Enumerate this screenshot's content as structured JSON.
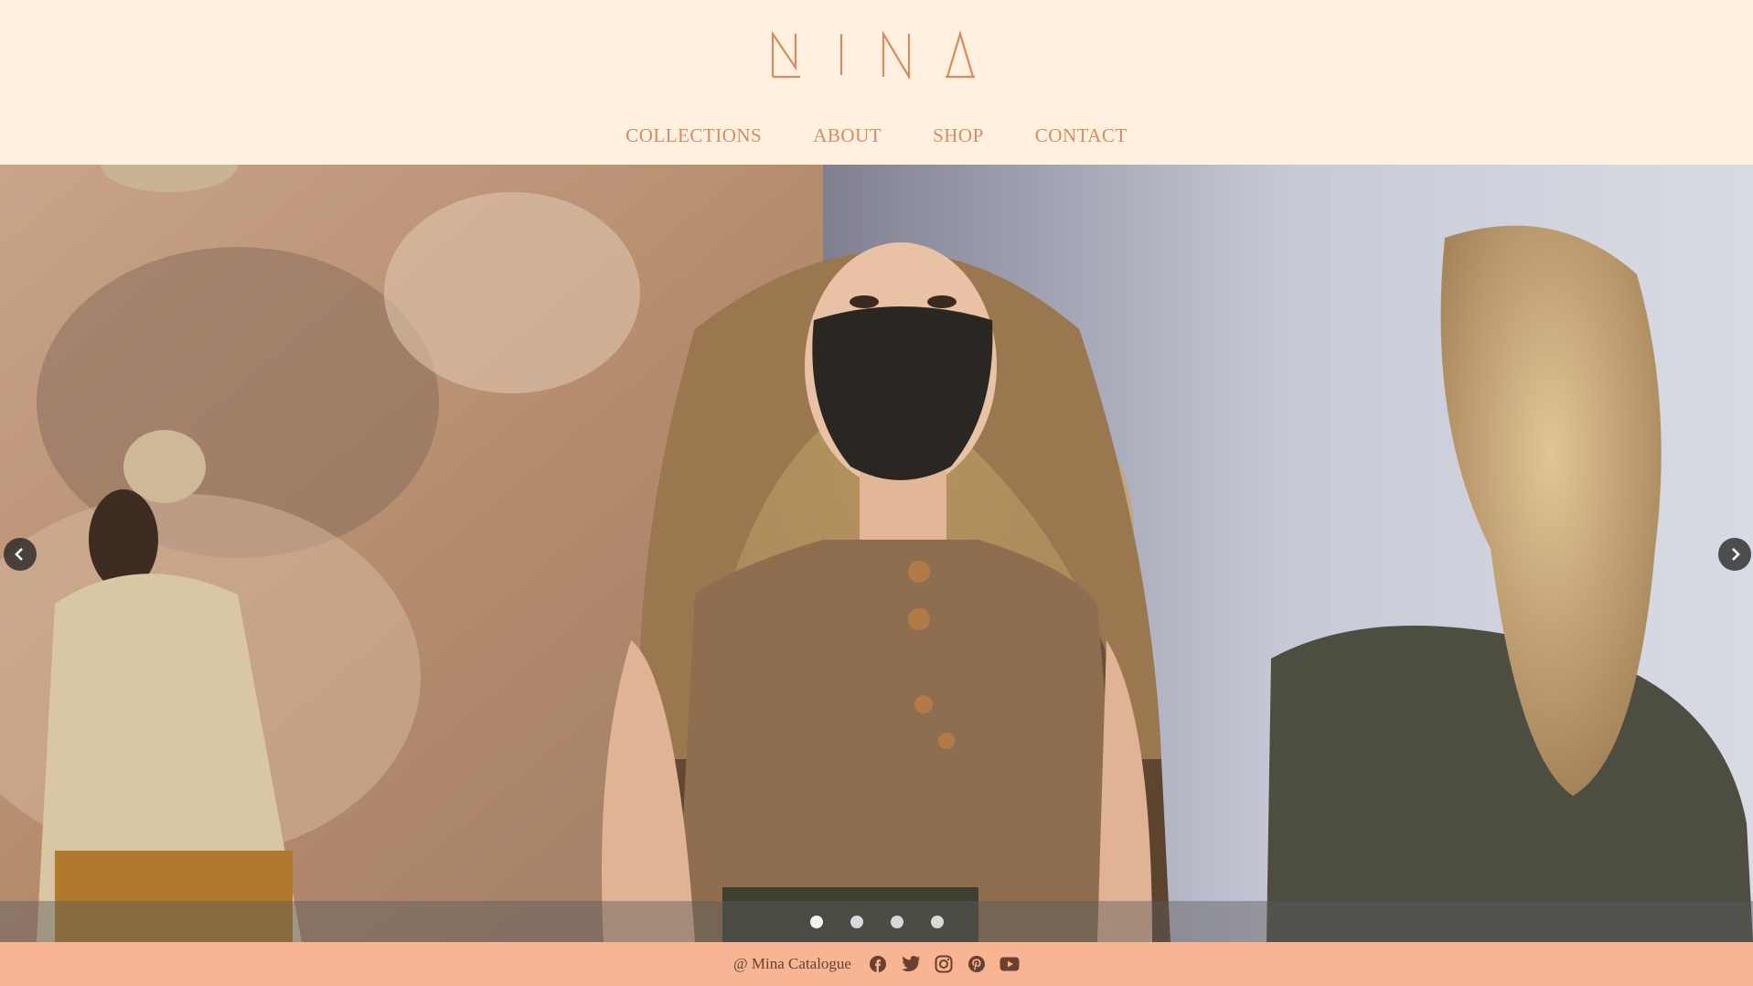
{
  "brand": {
    "logo_text": "MINA",
    "color": "#d98b5f"
  },
  "nav": {
    "items": [
      {
        "label": "COLLECTIONS"
      },
      {
        "label": "ABOUT"
      },
      {
        "label": "SHOP"
      },
      {
        "label": "CONTACT"
      }
    ]
  },
  "carousel": {
    "slide_count": 4,
    "active_index": 0,
    "prev_icon": "chevron-left-icon",
    "next_icon": "chevron-right-icon"
  },
  "footer": {
    "copyright": "@ Mina Catalogue",
    "background": "#f7b594",
    "social": [
      "facebook-icon",
      "twitter-icon",
      "instagram-icon",
      "pinterest-icon",
      "youtube-icon"
    ]
  }
}
